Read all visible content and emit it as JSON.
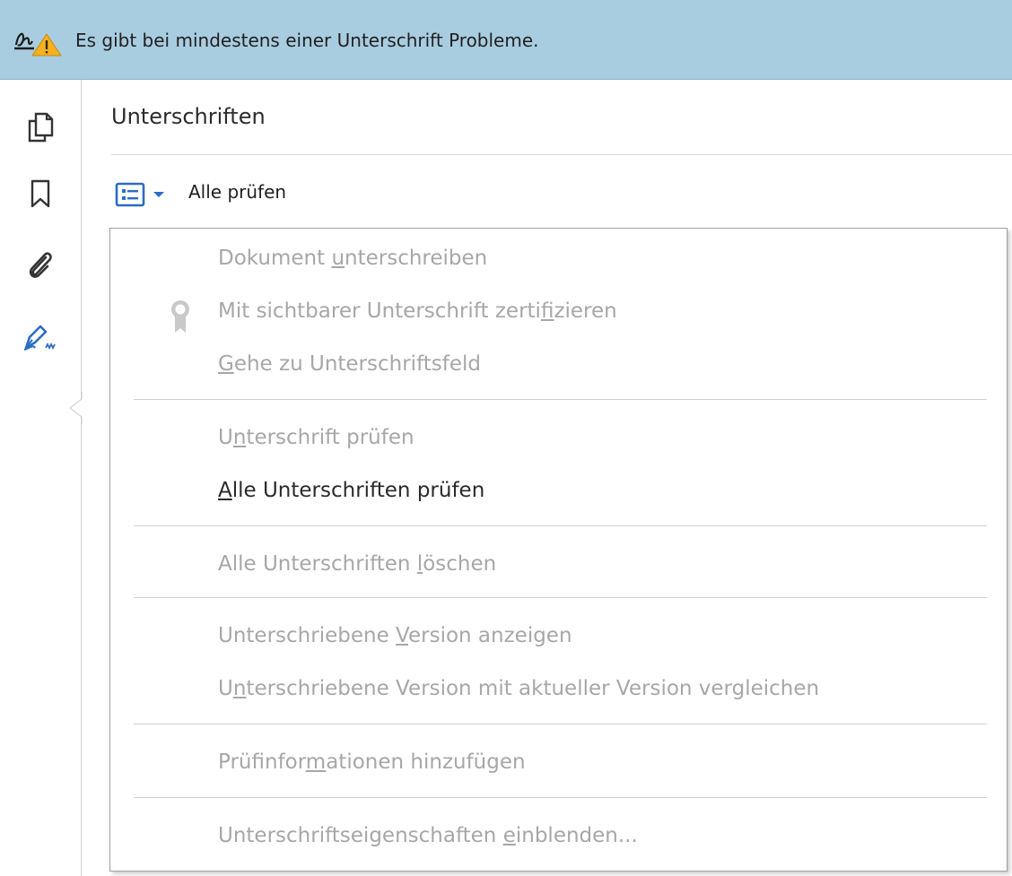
{
  "banner": {
    "message": "Es gibt bei mindestens einer Unterschrift Probleme."
  },
  "sidebar": {
    "tools": [
      "pages-icon",
      "bookmark-icon",
      "attachment-icon",
      "signature-pen-icon"
    ],
    "active_tool": "signature-pen-icon",
    "accent_color": "#2b6cc4"
  },
  "panel": {
    "title": "Unterschriften",
    "toolbar": {
      "options_icon": "list-options-icon",
      "verify_all_label": "Alle prüfen"
    }
  },
  "menu": {
    "items": [
      {
        "pre": "Dokument ",
        "key": "u",
        "post": "nterschreiben",
        "enabled": false
      },
      {
        "pre": "Mit sichtbarer Unterschrift zerti",
        "key": "f",
        "post": "izieren",
        "enabled": false,
        "icon": "certificate-ribbon-icon"
      },
      {
        "pre": "",
        "key": "G",
        "post": "ehe zu Unterschriftsfeld",
        "enabled": false
      },
      {
        "pre": "U",
        "key": "n",
        "post": "terschrift prüfen",
        "enabled": false
      },
      {
        "pre": "",
        "key": "A",
        "post": "lle Unterschriften prüfen",
        "enabled": true
      },
      {
        "pre": "Alle Unterschriften ",
        "key": "l",
        "post": "öschen",
        "enabled": false
      },
      {
        "pre": "Unterschriebene ",
        "key": "V",
        "post": "ersion anzeigen",
        "enabled": false
      },
      {
        "pre": "U",
        "key": "n",
        "post": "terschriebene Version mit aktueller Version vergleichen",
        "enabled": false
      },
      {
        "pre": "Prüfinfor",
        "key": "m",
        "post": "ationen hinzufügen",
        "enabled": false
      },
      {
        "pre": "Unterschriftseigenschaften ",
        "key": "e",
        "post": "inblenden...",
        "enabled": false
      }
    ]
  }
}
